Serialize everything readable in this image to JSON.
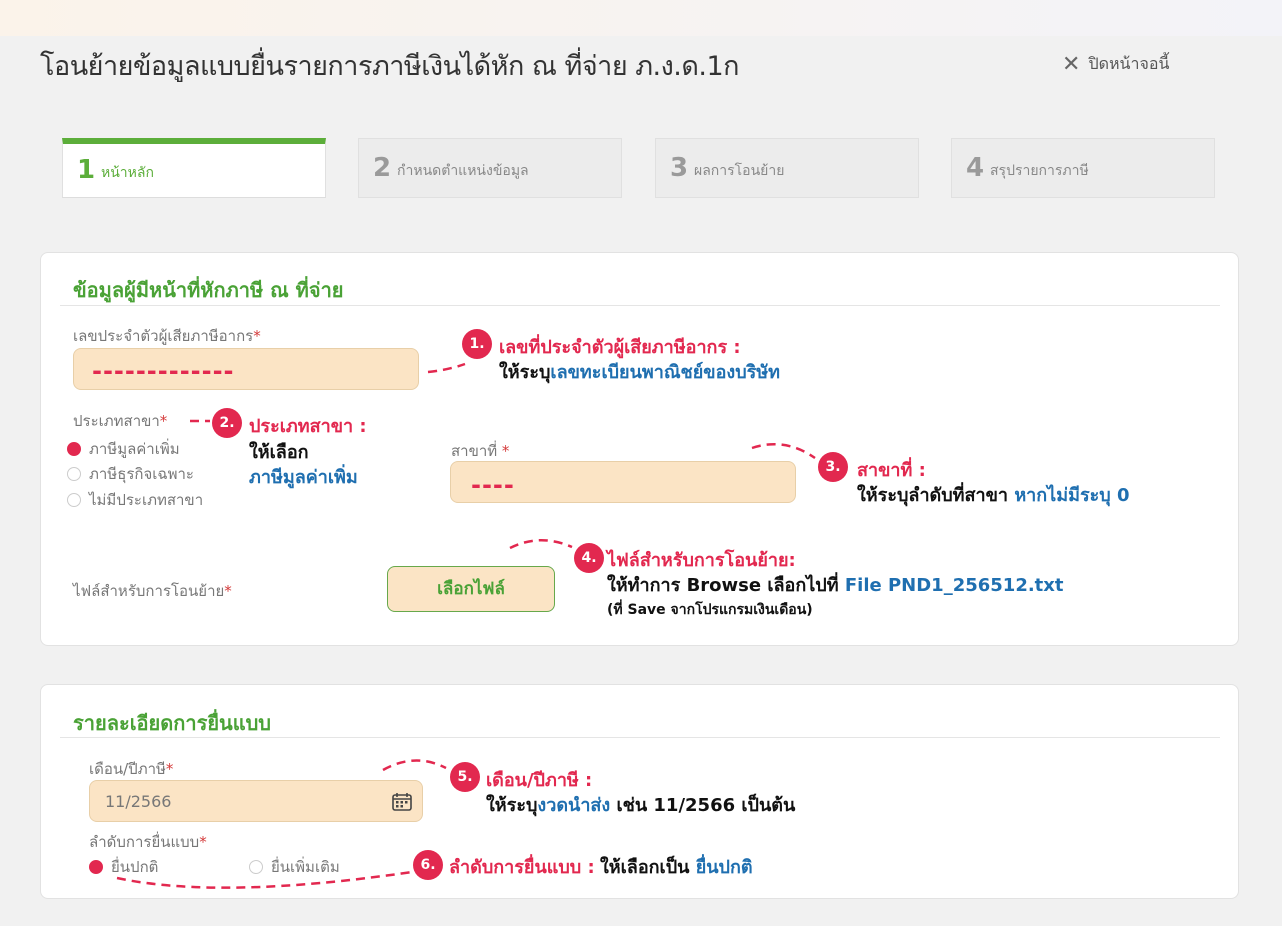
{
  "page": {
    "title": "โอนย้ายข้อมูลแบบยื่นรายการภาษีเงินได้หัก ณ ที่จ่าย ภ.ง.ด.1ก",
    "close_label": "ปิดหน้าจอนี้"
  },
  "steps": [
    {
      "num": "1",
      "label": "หน้าหลัก"
    },
    {
      "num": "2",
      "label": "กำหนดตำแหน่งข้อมูล"
    },
    {
      "num": "3",
      "label": "ผลการโอนย้าย"
    },
    {
      "num": "4",
      "label": "สรุปรายการภาษี"
    }
  ],
  "payer": {
    "title": "ข้อมูลผู้มีหน้าที่หักภาษี ณ ที่จ่าย",
    "tax_id_label": "เลขประจำตัวผู้เสียภาษีอากร",
    "tax_id_value": "-------------",
    "branch_type_label": "ประเภทสาขา",
    "branch_options": [
      "ภาษีมูลค่าเพิ่ม",
      "ภาษีธุรกิจเฉพาะ",
      "ไม่มีประเภทสาขา"
    ],
    "branch_no_label": "สาขาที่",
    "branch_no_value": "----",
    "file_label": "ไฟล์สำหรับการโอนย้าย",
    "file_button": "เลือกไฟล์"
  },
  "filing": {
    "title": "รายละเอียดการยื่นแบบ",
    "month_label": "เดือน/ปีภาษี",
    "month_value": "11/2566",
    "order_label": "ลำดับการยื่นแบบ",
    "order_options": [
      "ยื่นปกติ",
      "ยื่นเพิ่มเติม"
    ]
  },
  "annotations": {
    "a1": {
      "badge": "1.",
      "title": "เลขที่ประจำตัวผู้เสียภาษีอากร :",
      "pre": "ให้ระบุ",
      "blue": "เลขทะเบียนพาณิชย์ของบริษัท"
    },
    "a2": {
      "badge": "2.",
      "title": "ประเภทสาขา :",
      "line1": "ให้เลือก",
      "blue": "ภาษีมูลค่าเพิ่ม"
    },
    "a3": {
      "badge": "3.",
      "title": "สาขาที่ :",
      "pre": "ให้ระบุลำดับที่สาขา ",
      "blue": "หากไม่มีระบุ 0"
    },
    "a4": {
      "badge": "4.",
      "title": "ไฟล์สำหรับการโอนย้าย:",
      "pre": "ให้ทำการ Browse เลือกไปที่ ",
      "blue": "File PND1_256512.txt",
      "note": "(ที่ Save จากโปรแกรมเงินเดือน)"
    },
    "a5": {
      "badge": "5.",
      "title": "เดือน/ปีภาษี :",
      "pre": "ให้ระบุ",
      "blue": "งวดนำส่ง",
      "post": " เช่น 11/2566 เป็นต้น"
    },
    "a6": {
      "badge": "6.",
      "title": "ลำดับการยื่นแบบ :",
      "pre": " ให้เลือกเป็น ",
      "blue": "ยื่นปกติ"
    }
  },
  "colors": {
    "accent_green": "#4aa236",
    "annotation_red": "#e2284f",
    "annotation_blue": "#1f6fb0",
    "input_fill": "#fbe4c5"
  }
}
